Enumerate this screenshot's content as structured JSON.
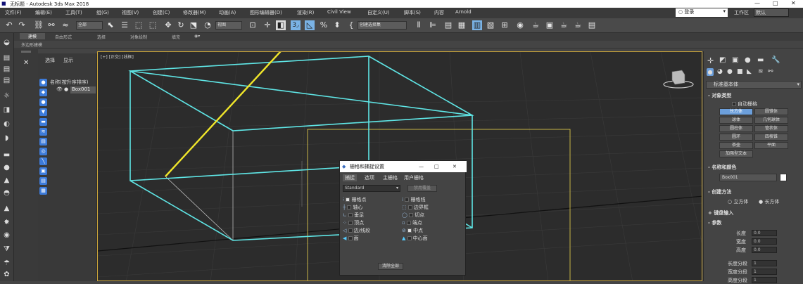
{
  "window": {
    "title": "无标题 - Autodesk 3ds Max 2018",
    "minimize": "—",
    "maximize": "□",
    "close": "✕"
  },
  "menu": {
    "items": [
      "文件(F)",
      "编辑(E)",
      "工具(T)",
      "组(G)",
      "视图(V)",
      "创建(C)",
      "修改器(M)",
      "动画(A)",
      "图形编辑器(D)",
      "渲染(R)",
      "Civil View",
      "自定义(U)",
      "脚本(S)",
      "内容",
      "Arnold"
    ],
    "signin": "登录",
    "workspace": "工作区",
    "workspace_value": "默认"
  },
  "toolbar": {
    "selection_filter": "全部",
    "reference_coord": "视图",
    "named_selection": "创建选择集"
  },
  "ribbon": {
    "tabs": [
      "建模",
      "自由形式",
      "选择",
      "对象绘制",
      "填充"
    ],
    "subtitle": "多边形建模"
  },
  "explorer": {
    "tabs": [
      "选择",
      "显示"
    ],
    "column_header": "名称(按升序排序)",
    "item": "Box001"
  },
  "viewport": {
    "label": "[+] [正交] [线框]"
  },
  "dialog": {
    "title": "栅格和捕捉设置",
    "tabs": [
      "捕捉",
      "选项",
      "主栅格",
      "用户栅格"
    ],
    "dropdown": "Standard",
    "override": "禁用覆盖",
    "left_items": [
      "栅格点",
      "轴心",
      "垂足",
      "顶点",
      "边/线段",
      "面"
    ],
    "right_items": [
      "栅格线",
      "边界框",
      "切点",
      "端点",
      "中点",
      "中心面"
    ],
    "left_checked": [
      true,
      false,
      false,
      false,
      false,
      false
    ],
    "right_checked": [
      false,
      false,
      false,
      false,
      true,
      false
    ],
    "clear_button": "清除全部"
  },
  "cmdpanel": {
    "category": "标准基本体",
    "object_type_header": "对象类型",
    "autogrid": "自动栅格",
    "buttons": [
      "长方体",
      "圆锥体",
      "球体",
      "几何球体",
      "圆柱体",
      "管状体",
      "圆环",
      "四棱锥",
      "茶壶",
      "平面",
      "加强型文本"
    ],
    "name_color_header": "名称和颜色",
    "object_name": "Box001",
    "object_color": "#ffffff",
    "create_method_header": "创建方法",
    "create_method_opts": [
      "立方体",
      "长方体"
    ],
    "create_method_selected": "长方体",
    "keyboard_header": "键盘输入",
    "params_header": "参数",
    "params": [
      {
        "label": "长度",
        "value": "0.0"
      },
      {
        "label": "宽度",
        "value": "0.0"
      },
      {
        "label": "高度",
        "value": "0.0"
      },
      {
        "label": "长度分段",
        "value": "1"
      },
      {
        "label": "宽度分段",
        "value": "1"
      },
      {
        "label": "高度分段",
        "value": "1"
      }
    ]
  },
  "colors": {
    "box_wire": "#5fe6e6",
    "grid_selected": "#d8c34a",
    "arrow": "#f0e62a",
    "accent": "#6c9fdb"
  }
}
